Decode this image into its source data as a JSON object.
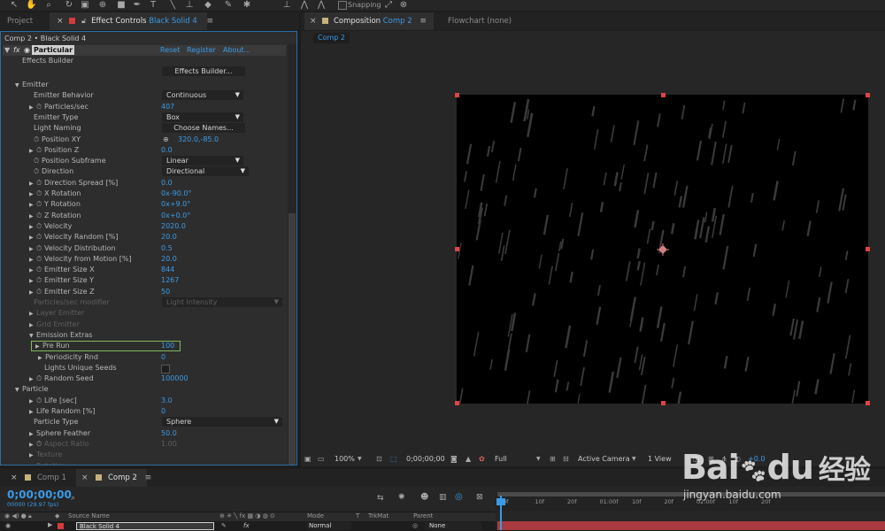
{
  "toolbar": {
    "snapping_label": "Snapping"
  },
  "left_panel": {
    "tabs": [
      {
        "label": "Project"
      },
      {
        "label": "Effect Controls",
        "layer": "Black Solid 4"
      }
    ],
    "breadcrumb": "Comp 2 • Black Solid 4",
    "effect": {
      "name": "Particular",
      "reset": "Reset",
      "register": "Register",
      "about": "About...",
      "builder_label": "Effects Builder",
      "builder_button": "Effects Builder..."
    },
    "rows": [
      {
        "label": "Emitter",
        "level": 0,
        "tri": "down"
      },
      {
        "label": "Emitter Behavior",
        "level": 2,
        "dd": "Continuous"
      },
      {
        "label": "Particles/sec",
        "level": 1,
        "tri": "right",
        "sw": true,
        "value": "407"
      },
      {
        "label": "Emitter Type",
        "level": 2,
        "dd": "Box"
      },
      {
        "label": "Light Naming",
        "level": 2,
        "btn": "Choose Names..."
      },
      {
        "label": "Position XY",
        "level": 2,
        "sw": true,
        "pos": "320.0,-85.0"
      },
      {
        "label": "Position Z",
        "level": 1,
        "tri": "right",
        "sw": true,
        "value": "0.0"
      },
      {
        "label": "Position Subframe",
        "level": 2,
        "sw": true,
        "dd": "Linear"
      },
      {
        "label": "Direction",
        "level": 2,
        "sw": true,
        "dd": "Directional",
        "ddw": 98
      },
      {
        "label": "Direction Spread [%]",
        "level": 1,
        "tri": "right",
        "sw": true,
        "value": "0.0"
      },
      {
        "label": "X Rotation",
        "level": 1,
        "tri": "right",
        "sw": true,
        "value": "0x-90.0°"
      },
      {
        "label": "Y Rotation",
        "level": 1,
        "tri": "right",
        "sw": true,
        "value": "0x+9.0°"
      },
      {
        "label": "Z Rotation",
        "level": 1,
        "tri": "right",
        "sw": true,
        "value": "0x+0.0°"
      },
      {
        "label": "Velocity",
        "level": 1,
        "tri": "right",
        "sw": true,
        "value": "2020.0"
      },
      {
        "label": "Velocity Random [%]",
        "level": 1,
        "tri": "right",
        "sw": true,
        "value": "20.0"
      },
      {
        "label": "Velocity Distribution",
        "level": 1,
        "tri": "right",
        "sw": true,
        "value": "0.5"
      },
      {
        "label": "Velocity from Motion [%]",
        "level": 1,
        "tri": "right",
        "sw": true,
        "value": "20.0"
      },
      {
        "label": "Emitter Size X",
        "level": 1,
        "tri": "right",
        "sw": true,
        "value": "844"
      },
      {
        "label": "Emitter Size Y",
        "level": 1,
        "tri": "right",
        "sw": true,
        "value": "1267"
      },
      {
        "label": "Emitter Size Z",
        "level": 1,
        "tri": "right",
        "sw": true,
        "value": "50"
      },
      {
        "label": "Particles/sec modifier",
        "level": 2,
        "dd": "Light Intensity",
        "dim": true,
        "ddw": 136
      },
      {
        "label": "Layer Emitter",
        "level": 1,
        "tri": "right",
        "dim": true
      },
      {
        "label": "Grid Emitter",
        "level": 1,
        "tri": "right",
        "dim": true
      },
      {
        "label": "Emission Extras",
        "level": 1,
        "tri": "down"
      },
      {
        "label": "Pre Run",
        "level": 3,
        "tri": "right",
        "value": "100",
        "selected": true
      },
      {
        "label": "Periodicity Rnd",
        "level": 3,
        "tri": "right",
        "value": "0"
      },
      {
        "label": "Lights Unique Seeds",
        "level": 4,
        "checkbox": true
      },
      {
        "label": "Random Seed",
        "level": 1,
        "tri": "right",
        "sw": true,
        "value": "100000"
      },
      {
        "label": "Particle",
        "level": 0,
        "tri": "down"
      },
      {
        "label": "Life [sec]",
        "level": 1,
        "tri": "right",
        "sw": true,
        "value": "3.0"
      },
      {
        "label": "Life Random [%]",
        "level": 1,
        "tri": "right",
        "value": "0"
      },
      {
        "label": "Particle Type",
        "level": 2,
        "dd": "Sphere",
        "ddw": 136
      },
      {
        "label": "Sphere Feather",
        "level": 1,
        "tri": "right",
        "value": "50.0"
      },
      {
        "label": "Aspect Ratio",
        "level": 1,
        "tri": "right",
        "sw": true,
        "value": "1.00",
        "dim": true
      },
      {
        "label": "Texture",
        "level": 1,
        "tri": "right",
        "dim": true
      },
      {
        "label": "Rotation",
        "level": 1,
        "tri": "right",
        "dim": true
      }
    ]
  },
  "right_panel": {
    "tabs": [
      {
        "label": "Composition",
        "comp": "Comp 2"
      },
      {
        "label": "Flowchart (none)"
      }
    ],
    "sub_tab": "Comp 2",
    "footer": {
      "zoom": "100%",
      "time": "0;00;00;00",
      "resolution": "Full",
      "camera": "Active Camera",
      "view": "1 View",
      "offset": "+0.0"
    }
  },
  "timeline": {
    "tabs": [
      {
        "label": "Comp 1"
      },
      {
        "label": "Comp 2"
      }
    ],
    "timecode": "0;00;00;00",
    "fps": "00000 (29.97 fps)",
    "search_placeholder": "",
    "columns": {
      "source": "Source Name",
      "mode": "Mode",
      "t": "T",
      "trkmat": "TrkMat",
      "parent": "Parent"
    },
    "layer": {
      "name": "Black Solid 4",
      "mode": "Normal",
      "parent": "None"
    },
    "ruler": [
      "0f",
      "10f",
      "20f",
      "01:00f",
      "10f",
      "20f",
      "02:00f",
      "10f",
      "20f"
    ]
  },
  "watermark": {
    "brand": "Bai",
    "brand2": "du",
    "cn": "经验",
    "url": "jingyan.baidu.com"
  },
  "colors": {
    "accent": "#3b9be6",
    "handle": "#e04444",
    "layer_bar": "#a93a3f",
    "selection": "#7fb85c"
  }
}
